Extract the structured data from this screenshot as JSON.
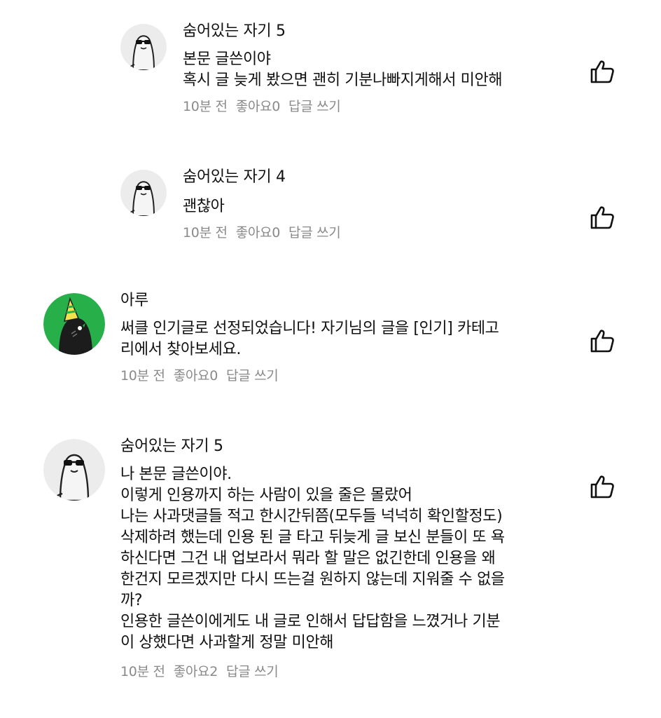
{
  "comments": [
    {
      "author": "숨어있는 자기 5",
      "avatar": "sunglasses-ghost",
      "lines": [
        "본문 글쓴이야",
        "혹시 글 늦게 봤으면 괜히 기분나빠지게해서 미안해"
      ],
      "time": "10분 전",
      "likes": "좋아요0",
      "reply": "답글 쓰기"
    },
    {
      "author": "숨어있는 자기 4",
      "avatar": "sunglasses-ghost",
      "lines": [
        "괜찮아"
      ],
      "time": "10분 전",
      "likes": "좋아요0",
      "reply": "답글 쓰기"
    },
    {
      "author": "아루",
      "avatar": "party-bird",
      "lines": [
        "써클 인기글로 선정되었습니다! 자기님의 글을 [인기] 카테고",
        "리에서 찾아보세요."
      ],
      "time": "10분 전",
      "likes": "좋아요0",
      "reply": "답글 쓰기"
    },
    {
      "author": "숨어있는 자기 5",
      "avatar": "sunglasses-ghost",
      "lines": [
        "나 본문 글쓴이야.",
        "이렇게 인용까지 하는 사람이 있을 줄은 몰랐어",
        "나는 사과댓글들 적고 한시간뒤쯤(모두들 넉넉히 확인할정도)",
        "삭제하려 했는데 인용 된 글 타고 뒤늦게 글 보신 분들이 또 욕",
        "하신다면 그건 내 업보라서 뭐라 할 말은 없긴한데 인용을 왜",
        "한건지 모르겠지만 다시 뜨는걸 원하지 않는데 지워줄 수 없을",
        "까?",
        "인용한 글쓴이에게도 내 글로 인해서 답답함을 느꼈거나 기분",
        "이 상했다면 사과할게 정말 미안해"
      ],
      "time": "10분 전",
      "likes": "좋아요2",
      "reply": "답글 쓰기"
    }
  ],
  "colors": {
    "meta_text": "#8a8a8a",
    "avatar_bg": "#ececec",
    "party_green": "#27b04a"
  },
  "icons": {
    "like": "thumbs-up-icon"
  }
}
